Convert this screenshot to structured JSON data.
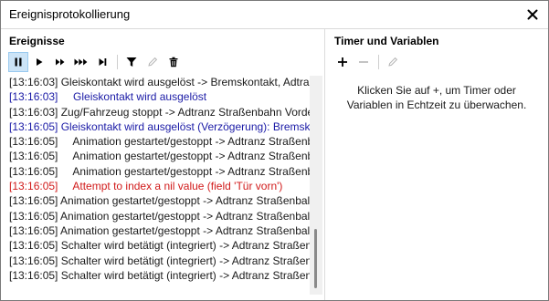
{
  "window": {
    "title": "Ereignisprotokollierung"
  },
  "events": {
    "title": "Ereignisse",
    "toolbar": {
      "pause": "pause-icon",
      "play": "play-icon",
      "fast": "fast-forward-icon",
      "faster": "fastest-forward-icon",
      "skip_end": "skip-to-end-icon",
      "filter": "filter-icon",
      "edit": "pencil-icon",
      "delete": "trash-icon"
    },
    "lines": [
      {
        "text": "[13:16:03] Gleiskontakt wird ausgelöst -> Bremskontakt, Adtranz",
        "color": "default"
      },
      {
        "text": "[13:16:03]     Gleiskontakt wird ausgelöst",
        "color": "blue"
      },
      {
        "text": "[13:16:03] Zug/Fahrzeug stoppt -> Adtranz Straßenbahn Vorde",
        "color": "default"
      },
      {
        "text": "[13:16:05] Gleiskontakt wird ausgelöst (Verzögerung): Bremsko",
        "color": "blue"
      },
      {
        "text": "[13:16:05]     Animation gestartet/gestoppt -> Adtranz Straßenb",
        "color": "default"
      },
      {
        "text": "[13:16:05]     Animation gestartet/gestoppt -> Adtranz Straßenb",
        "color": "default"
      },
      {
        "text": "[13:16:05]     Animation gestartet/gestoppt -> Adtranz Straßenb",
        "color": "default"
      },
      {
        "text": "[13:16:05]     Attempt to index a nil value (field 'Tür vorn')",
        "color": "red"
      },
      {
        "text": "[13:16:05] Animation gestartet/gestoppt -> Adtranz Straßenbal",
        "color": "default"
      },
      {
        "text": "[13:16:05] Animation gestartet/gestoppt -> Adtranz Straßenbal",
        "color": "default"
      },
      {
        "text": "[13:16:05] Animation gestartet/gestoppt -> Adtranz Straßenbal",
        "color": "default"
      },
      {
        "text": "[13:16:05] Schalter wird betätigt (integriert) -> Adtranz Straßen",
        "color": "default"
      },
      {
        "text": "[13:16:05] Schalter wird betätigt (integriert) -> Adtranz Straßen",
        "color": "default"
      },
      {
        "text": "[13:16:05] Schalter wird betätigt (integriert) -> Adtranz Straßen",
        "color": "default"
      }
    ]
  },
  "timers": {
    "title": "Timer und Variablen",
    "toolbar": {
      "add": "plus-icon",
      "remove": "minus-icon",
      "edit": "pencil-icon"
    },
    "hint": "Klicken Sie auf +, um Timer oder Variablen in Echtzeit zu überwachen."
  },
  "colors": {
    "blue": "#1a1aa6",
    "red": "#d11a1a",
    "default": "#1a1a1a",
    "active_button": "#cce4f7"
  }
}
